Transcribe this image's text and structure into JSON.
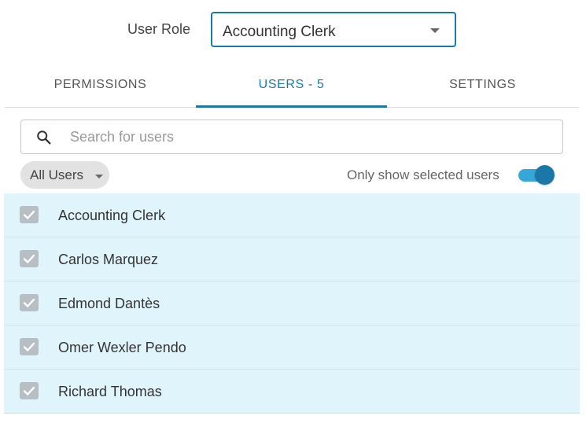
{
  "role": {
    "label": "User Role",
    "selected_value": "Accounting Clerk"
  },
  "tabs": [
    {
      "label": "PERMISSIONS",
      "active": false
    },
    {
      "label": "USERS - 5",
      "active": true
    },
    {
      "label": "SETTINGS",
      "active": false
    }
  ],
  "search": {
    "placeholder": "Search for users",
    "value": ""
  },
  "filter": {
    "chip_label": "All Users",
    "only_selected_label": "Only show selected users",
    "only_selected_on": true
  },
  "users": [
    {
      "name": "Accounting Clerk",
      "checked": true
    },
    {
      "name": "Carlos Marquez",
      "checked": true
    },
    {
      "name": "Edmond Dantès",
      "checked": true
    },
    {
      "name": "Omer Wexler Pendo",
      "checked": true
    },
    {
      "name": "Richard Thomas",
      "checked": true
    }
  ],
  "colors": {
    "accent": "#1a78a8",
    "toggle_track": "#35a8d8",
    "row_selected_bg": "#e0f4fc",
    "checkbox": "#b7bfc4",
    "chip_bg": "#e2e2e2"
  },
  "icons": {
    "search": "search-icon",
    "dropdown": "chevron-down-icon",
    "check": "check-icon"
  }
}
